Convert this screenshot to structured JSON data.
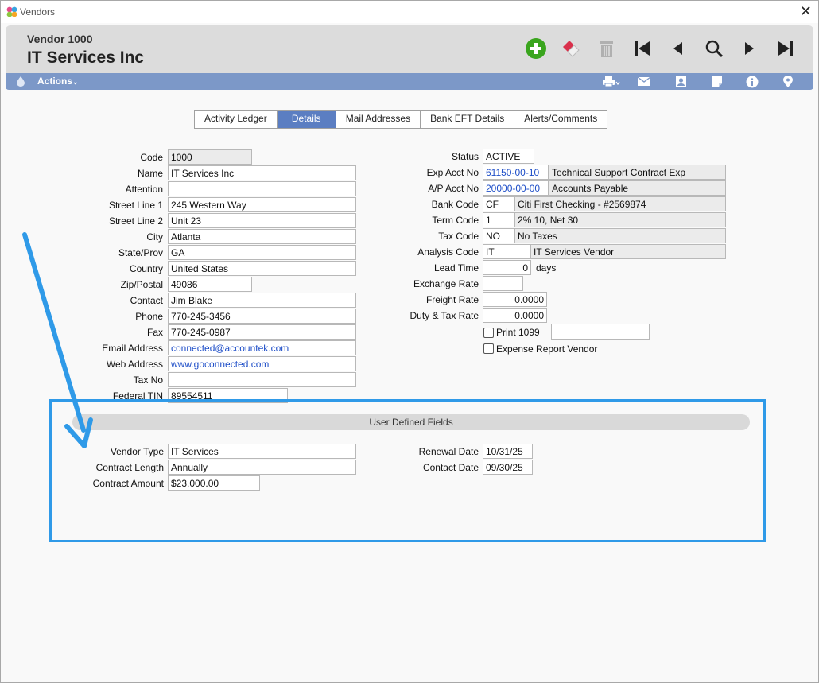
{
  "window": {
    "title": "Vendors",
    "close_glyph": "✕"
  },
  "header": {
    "vendor_label": "Vendor 1000",
    "vendor_name": "IT Services Inc"
  },
  "toolbar": {
    "icons": [
      "add-icon",
      "eraser-icon",
      "trash-icon",
      "first-record-icon",
      "previous-record-icon",
      "search-icon",
      "next-record-icon",
      "last-record-icon"
    ]
  },
  "actionbar": {
    "actions_label": "Actions",
    "icons": [
      "print-icon",
      "mail-icon",
      "contact-card-icon",
      "note-icon",
      "info-icon",
      "location-pin-icon"
    ]
  },
  "tabs": [
    {
      "label": "Activity Ledger",
      "active": false
    },
    {
      "label": "Details",
      "active": true
    },
    {
      "label": "Mail Addresses",
      "active": false
    },
    {
      "label": "Bank EFT Details",
      "active": false
    },
    {
      "label": "Alerts/Comments",
      "active": false
    }
  ],
  "left_fields": {
    "code": {
      "label": "Code",
      "value": "1000"
    },
    "name": {
      "label": "Name",
      "value": "IT Services Inc"
    },
    "attention": {
      "label": "Attention",
      "value": ""
    },
    "street1": {
      "label": "Street Line 1",
      "value": "245 Western Way"
    },
    "street2": {
      "label": "Street Line 2",
      "value": "Unit 23"
    },
    "city": {
      "label": "City",
      "value": "Atlanta"
    },
    "state": {
      "label": "State/Prov",
      "value": "GA"
    },
    "country": {
      "label": "Country",
      "value": "United States"
    },
    "zip": {
      "label": "Zip/Postal",
      "value": "49086"
    },
    "contact": {
      "label": "Contact",
      "value": "Jim Blake"
    },
    "phone": {
      "label": "Phone",
      "value": "770-245-3456"
    },
    "fax": {
      "label": "Fax",
      "value": "770-245-0987"
    },
    "email": {
      "label": "Email Address",
      "value": "connected@accountek.com"
    },
    "web": {
      "label": "Web Address",
      "value": "www.goconnected.com"
    },
    "taxno": {
      "label": "Tax No",
      "value": ""
    },
    "fedtin": {
      "label": "Federal TIN",
      "value": "89554511"
    }
  },
  "right_fields": {
    "status": {
      "label": "Status",
      "value": "ACTIVE"
    },
    "exp_acct": {
      "label": "Exp Acct No",
      "value": "61150-00-10",
      "desc": "Technical Support Contract Exp"
    },
    "ap_acct": {
      "label": "A/P Acct No",
      "value": "20000-00-00",
      "desc": "Accounts Payable"
    },
    "bank_code": {
      "label": "Bank Code",
      "value": "CF",
      "desc": "Citi First Checking - #2569874"
    },
    "term_code": {
      "label": "Term Code",
      "value": "1",
      "desc": "2% 10, Net 30"
    },
    "tax_code": {
      "label": "Tax Code",
      "value": "NO",
      "desc": "No Taxes"
    },
    "analysis_code": {
      "label": "Analysis Code",
      "value": "IT",
      "desc": "IT Services Vendor"
    },
    "lead_time": {
      "label": "Lead Time",
      "value": "0",
      "unit": "days"
    },
    "exchange_rate": {
      "label": "Exchange Rate",
      "value": ""
    },
    "freight_rate": {
      "label": "Freight Rate",
      "value": "0.0000"
    },
    "duty_tax_rate": {
      "label": "Duty & Tax Rate",
      "value": "0.0000"
    },
    "print1099": {
      "label": "Print 1099",
      "checked": false,
      "value": ""
    },
    "expense_report": {
      "label": "Expense Report Vendor",
      "checked": false
    }
  },
  "udf": {
    "title": "User Defined Fields",
    "vendor_type": {
      "label": "Vendor Type",
      "value": "IT Services"
    },
    "contract_length": {
      "label": "Contract Length",
      "value": "Annually"
    },
    "contract_amount": {
      "label": "Contract Amount",
      "value": "$23,000.00"
    },
    "renewal_date": {
      "label": "Renewal Date",
      "value": "10/31/25"
    },
    "contact_date": {
      "label": "Contact Date",
      "value": "09/30/25"
    }
  },
  "annotation": {
    "arrow_color": "#2f9ae8",
    "box_color": "#2f9ae8"
  },
  "colors": {
    "accent": "#5b7ec2",
    "actionbar": "#7c98c8",
    "add_green": "#3aa51e",
    "link_blue": "#1f4fc8"
  }
}
